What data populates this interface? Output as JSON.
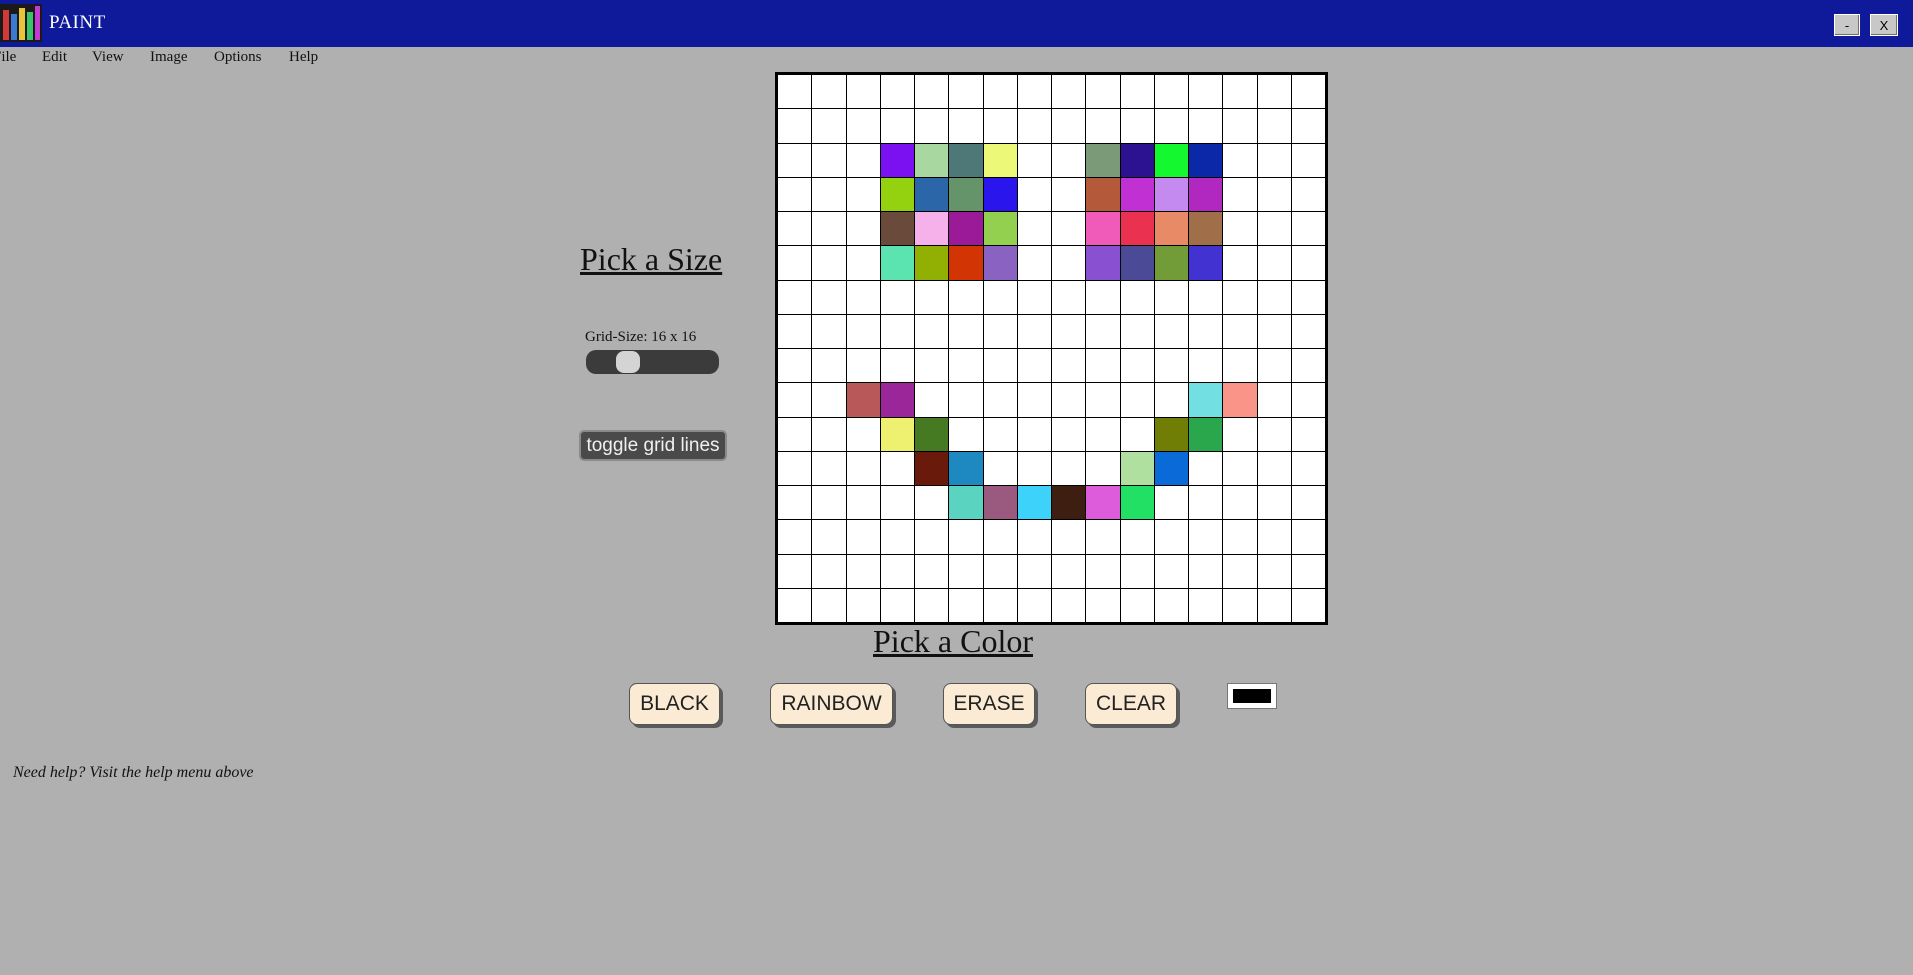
{
  "window": {
    "title": "PAINT",
    "minimize_label": "-",
    "close_label": "X"
  },
  "menu": [
    "File",
    "Edit",
    "View",
    "Image",
    "Options",
    "Help"
  ],
  "size_panel": {
    "heading": "Pick a Size",
    "grid_size_label": "Grid-Size: 16 x 16",
    "slider_value": 16,
    "slider_min": 2,
    "slider_max": 100,
    "toggle_label": "toggle grid lines"
  },
  "canvas": {
    "rows": 16,
    "cols": 16,
    "default_color": "#ffffff",
    "grid_line_color": "#000000",
    "painted_cells": [
      {
        "r": 2,
        "c": 3,
        "color": "#7b10f0"
      },
      {
        "r": 2,
        "c": 4,
        "color": "#a8d8a0"
      },
      {
        "r": 2,
        "c": 5,
        "color": "#4e7878"
      },
      {
        "r": 2,
        "c": 6,
        "color": "#ecf878"
      },
      {
        "r": 2,
        "c": 9,
        "color": "#7a9a78"
      },
      {
        "r": 2,
        "c": 10,
        "color": "#2c1290"
      },
      {
        "r": 2,
        "c": 11,
        "color": "#14f830"
      },
      {
        "r": 2,
        "c": 12,
        "color": "#0b28a8"
      },
      {
        "r": 3,
        "c": 3,
        "color": "#94d210"
      },
      {
        "r": 3,
        "c": 4,
        "color": "#2a66a8"
      },
      {
        "r": 3,
        "c": 5,
        "color": "#66946a"
      },
      {
        "r": 3,
        "c": 6,
        "color": "#2a16ec"
      },
      {
        "r": 3,
        "c": 9,
        "color": "#b45a3a"
      },
      {
        "r": 3,
        "c": 10,
        "color": "#c030d2"
      },
      {
        "r": 3,
        "c": 11,
        "color": "#c48af0"
      },
      {
        "r": 3,
        "c": 12,
        "color": "#b028c0"
      },
      {
        "r": 4,
        "c": 3,
        "color": "#6a4a3a"
      },
      {
        "r": 4,
        "c": 4,
        "color": "#f6b0ea"
      },
      {
        "r": 4,
        "c": 5,
        "color": "#9a1a98"
      },
      {
        "r": 4,
        "c": 6,
        "color": "#94d050"
      },
      {
        "r": 4,
        "c": 9,
        "color": "#f05ab8"
      },
      {
        "r": 4,
        "c": 10,
        "color": "#ea3250"
      },
      {
        "r": 4,
        "c": 11,
        "color": "#e88a66"
      },
      {
        "r": 4,
        "c": 12,
        "color": "#a06e48"
      },
      {
        "r": 5,
        "c": 3,
        "color": "#5ce4b0"
      },
      {
        "r": 5,
        "c": 4,
        "color": "#92b004"
      },
      {
        "r": 5,
        "c": 5,
        "color": "#d23404"
      },
      {
        "r": 5,
        "c": 6,
        "color": "#8a62c2"
      },
      {
        "r": 5,
        "c": 9,
        "color": "#8a50d2"
      },
      {
        "r": 5,
        "c": 10,
        "color": "#4a4a96"
      },
      {
        "r": 5,
        "c": 11,
        "color": "#729c38"
      },
      {
        "r": 5,
        "c": 12,
        "color": "#4232d2"
      },
      {
        "r": 9,
        "c": 2,
        "color": "#b85858"
      },
      {
        "r": 9,
        "c": 3,
        "color": "#9a269a"
      },
      {
        "r": 9,
        "c": 12,
        "color": "#72e0e2"
      },
      {
        "r": 9,
        "c": 13,
        "color": "#fa9488"
      },
      {
        "r": 10,
        "c": 3,
        "color": "#eef070"
      },
      {
        "r": 10,
        "c": 4,
        "color": "#467a22"
      },
      {
        "r": 10,
        "c": 11,
        "color": "#707e06"
      },
      {
        "r": 10,
        "c": 12,
        "color": "#2aa64c"
      },
      {
        "r": 11,
        "c": 4,
        "color": "#6a1a0a"
      },
      {
        "r": 11,
        "c": 5,
        "color": "#1e88c0"
      },
      {
        "r": 11,
        "c": 10,
        "color": "#b0e0a0"
      },
      {
        "r": 11,
        "c": 11,
        "color": "#0a6ad8"
      },
      {
        "r": 12,
        "c": 5,
        "color": "#5ad4c0"
      },
      {
        "r": 12,
        "c": 6,
        "color": "#9a5a80"
      },
      {
        "r": 12,
        "c": 7,
        "color": "#3cd2fa"
      },
      {
        "r": 12,
        "c": 8,
        "color": "#3e1e10"
      },
      {
        "r": 12,
        "c": 9,
        "color": "#dc5cdc"
      },
      {
        "r": 12,
        "c": 10,
        "color": "#22e064"
      }
    ]
  },
  "color_panel": {
    "heading": "Pick a Color",
    "buttons": [
      "BLACK",
      "RAINBOW",
      "ERASE",
      "CLEAR"
    ],
    "selected_color": "#000000"
  },
  "help_text": "Need help? Visit the help menu above"
}
